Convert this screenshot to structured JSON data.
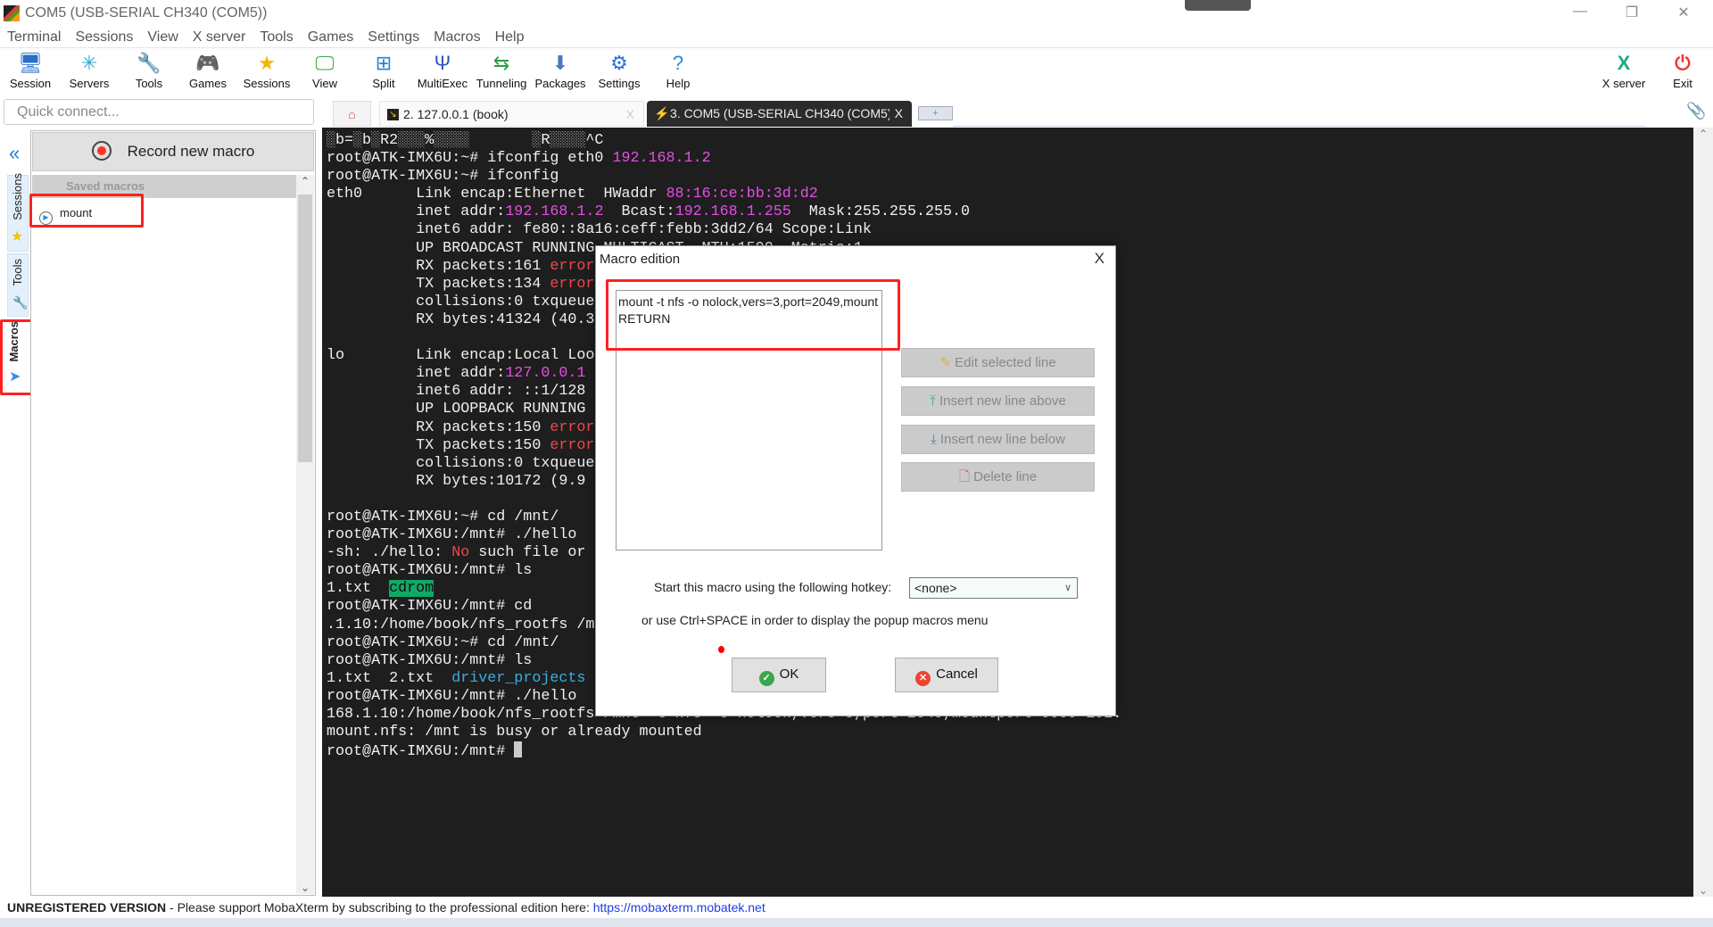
{
  "window": {
    "title": "COM5  (USB-SERIAL CH340 (COM5))",
    "minimize": "—",
    "restore": "❐",
    "close": "✕"
  },
  "menu": [
    "Terminal",
    "Sessions",
    "View",
    "X server",
    "Tools",
    "Games",
    "Settings",
    "Macros",
    "Help"
  ],
  "toolbar": [
    {
      "label": "Session",
      "icon": "session-icon",
      "glyph": "🖥"
    },
    {
      "label": "Servers",
      "icon": "servers-icon",
      "glyph": "✳"
    },
    {
      "label": "Tools",
      "icon": "tools-icon",
      "glyph": "🔧"
    },
    {
      "label": "Games",
      "icon": "games-icon",
      "glyph": "🎮"
    },
    {
      "label": "Sessions",
      "icon": "star-icon",
      "glyph": "★"
    },
    {
      "label": "View",
      "icon": "view-icon",
      "glyph": "🖵"
    },
    {
      "label": "Split",
      "icon": "split-icon",
      "glyph": "⊞"
    },
    {
      "label": "MultiExec",
      "icon": "multiexec-icon",
      "glyph": "Ψ"
    },
    {
      "label": "Tunneling",
      "icon": "tunneling-icon",
      "glyph": "⇆"
    },
    {
      "label": "Packages",
      "icon": "packages-icon",
      "glyph": "⬇"
    },
    {
      "label": "Settings",
      "icon": "settings-icon",
      "glyph": "⚙"
    },
    {
      "label": "Help",
      "icon": "help-icon",
      "glyph": "?"
    }
  ],
  "toolbar_right": [
    {
      "label": "X server",
      "icon": "xserver-icon",
      "glyph": "X"
    },
    {
      "label": "Exit",
      "icon": "power-icon",
      "glyph": "⏻"
    }
  ],
  "quick_connect": {
    "placeholder": "Quick connect..."
  },
  "tabs": [
    {
      "label": "2. 127.0.0.1 (book)",
      "close": "X",
      "active": false
    },
    {
      "label": "3. COM5  (USB-SERIAL CH340 (COM5))",
      "close": "X",
      "active": true
    }
  ],
  "new_tab": "+",
  "sidebar": {
    "tabs": [
      {
        "label": "Sessions"
      },
      {
        "label": "Tools"
      },
      {
        "label": "Macros",
        "active": true
      }
    ],
    "record_button": "Record new macro",
    "saved_macros_header": "Saved macros",
    "macros": [
      {
        "name": "mount"
      }
    ]
  },
  "colors": {
    "magenta": "#e84ce8",
    "red": "#f04848",
    "cyan": "#3aaee0",
    "green_bg": "#12a866",
    "highlight": "#ff2020",
    "terminal_bg": "#1e1e1e"
  },
  "terminal": {
    "lines": [
      [
        [
          "░b=░b░R2░░░%░░░░       ░R░░░░^C",
          ""
        ]
      ],
      [
        [
          "root@ATK-IMX6U:~# ifconfig eth0 ",
          ""
        ],
        [
          "192.168.1.2",
          "m"
        ]
      ],
      [
        [
          "root@ATK-IMX6U:~# ifconfig",
          ""
        ]
      ],
      [
        [
          "eth0      Link encap:Ethernet  HWaddr ",
          ""
        ],
        [
          "88:16:ce:bb:3d:d2",
          "m"
        ]
      ],
      [
        [
          "          inet addr:",
          ""
        ],
        [
          "192.168.1.2",
          "m"
        ],
        [
          "  Bcast:",
          ""
        ],
        [
          "192.168.1.255",
          "m"
        ],
        [
          "  Mask:255.255.255.0",
          ""
        ]
      ],
      [
        [
          "          inet6 addr: fe80::8a16:ceff:febb:3dd2/64 Scope:Link",
          ""
        ]
      ],
      [
        [
          "          UP BROADCAST RUNNING MULTICAST  MTU:1500  Metric:1",
          ""
        ]
      ],
      [
        [
          "          RX packets:161 ",
          ""
        ],
        [
          "error",
          "r"
        ]
      ],
      [
        [
          "          TX packets:134 ",
          ""
        ],
        [
          "error",
          "r"
        ]
      ],
      [
        [
          "          collisions:0 txqueue",
          ""
        ]
      ],
      [
        [
          "          RX bytes:41324 (40.3",
          ""
        ]
      ],
      [
        [
          "",
          ""
        ]
      ],
      [
        [
          "lo        Link encap:Local Loo",
          ""
        ]
      ],
      [
        [
          "          inet addr:",
          ""
        ],
        [
          "127.0.0.1",
          "m"
        ]
      ],
      [
        [
          "          inet6 addr: ::1/128",
          ""
        ]
      ],
      [
        [
          "          UP LOOPBACK RUNNING",
          ""
        ]
      ],
      [
        [
          "          RX packets:150 ",
          ""
        ],
        [
          "error",
          "r"
        ]
      ],
      [
        [
          "          TX packets:150 ",
          ""
        ],
        [
          "error",
          "r"
        ]
      ],
      [
        [
          "          collisions:0 txqueue",
          ""
        ]
      ],
      [
        [
          "          RX bytes:10172 (9.9",
          ""
        ]
      ],
      [
        [
          "",
          ""
        ]
      ],
      [
        [
          "root@ATK-IMX6U:~# cd /mnt/",
          ""
        ]
      ],
      [
        [
          "root@ATK-IMX6U:/mnt# ./hello",
          ""
        ]
      ],
      [
        [
          "-sh: ./hello: ",
          ""
        ],
        [
          "No",
          "r"
        ],
        [
          " such file or",
          ""
        ]
      ],
      [
        [
          "root@ATK-IMX6U:/mnt# ls",
          ""
        ]
      ],
      [
        [
          "1.txt  ",
          ""
        ],
        [
          "cdrom",
          "g"
        ]
      ],
      [
        [
          "root@ATK-IMX6U:/mnt# cd",
          ""
        ]
      ],
      [
        [
          ".1.10:/home/book/nfs_rootfs /m",
          ""
        ]
      ],
      [
        [
          "root@ATK-IMX6U:~# cd /mnt/",
          ""
        ]
      ],
      [
        [
          "root@ATK-IMX6U:/mnt# ls",
          ""
        ]
      ],
      [
        [
          "1.txt  2.txt  ",
          ""
        ],
        [
          "driver_projects",
          "c"
        ]
      ],
      [
        [
          "root@ATK-IMX6U:/mnt# ./hello",
          ""
        ]
      ],
      [
        [
          "168.1.10:/home/book/nfs_rootfs /mnt -t nfs -o nolock,vers=3,port=2049,mountport=9999 192.",
          ""
        ]
      ],
      [
        [
          "mount.nfs: /mnt is busy or already mounted",
          ""
        ]
      ],
      [
        [
          "root@ATK-IMX6U:/mnt# ",
          ""
        ]
      ]
    ]
  },
  "dialog": {
    "title": "Macro edition",
    "close": "X",
    "macro_lines": [
      "mount -t nfs -o nolock,vers=3,port=2049,mount",
      "RETURN"
    ],
    "buttons": [
      "Edit selected line",
      "Insert new line above",
      "Insert new line below",
      "Delete line"
    ],
    "hotkey_label": "Start this macro using the following hotkey:",
    "hotkey_value": "<none>",
    "hint": "or use Ctrl+SPACE in order to display the popup macros menu",
    "ok": "OK",
    "cancel": "Cancel"
  },
  "status": {
    "unregistered": "UNREGISTERED VERSION",
    "message": "  -  Please support MobaXterm by subscribing to the professional edition here:  ",
    "link": "https://mobaxterm.mobatek.net"
  }
}
